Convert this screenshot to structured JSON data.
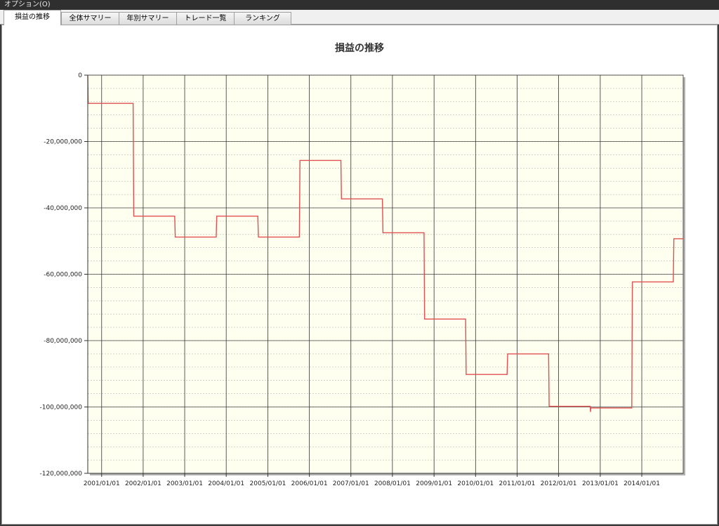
{
  "menu": {
    "options_label": "オプション(O)"
  },
  "tabs": [
    {
      "label": "損益の推移",
      "active": true
    },
    {
      "label": "全体サマリー",
      "active": false
    },
    {
      "label": "年別サマリー",
      "active": false
    },
    {
      "label": "トレード一覧",
      "active": false
    },
    {
      "label": "ランキング",
      "active": false
    }
  ],
  "chart_data": {
    "type": "line",
    "title": "損益の推移",
    "xlabel": "",
    "ylabel": "",
    "ylim": [
      -120000000,
      0
    ],
    "y_ticks": [
      0,
      -20000000,
      -40000000,
      -60000000,
      -80000000,
      -100000000,
      -120000000
    ],
    "y_tick_labels": [
      "0",
      "-20,000,000",
      "-40,000,000",
      "-60,000,000",
      "-80,000,000",
      "-100,000,000",
      "-120,000,000"
    ],
    "x_tick_labels": [
      "2001/01/01",
      "2002/01/01",
      "2003/01/01",
      "2004/01/01",
      "2005/01/01",
      "2006/01/01",
      "2007/01/01",
      "2008/01/01",
      "2009/01/01",
      "2010/01/01",
      "2011/01/01",
      "2012/01/01",
      "2013/01/01",
      "2014/01/01"
    ],
    "xlim": [
      "2000/09/01",
      "2014/12/31"
    ],
    "grid": true,
    "line_color": "#e05050",
    "plot_background": "#fffff0",
    "series": [
      {
        "name": "",
        "points": [
          [
            "2000/09/01",
            0
          ],
          [
            "2000/09/05",
            -8500000
          ],
          [
            "2001/10/05",
            -8500000
          ],
          [
            "2001/10/10",
            -42500000
          ],
          [
            "2002/10/05",
            -42500000
          ],
          [
            "2002/10/10",
            -48800000
          ],
          [
            "2003/10/05",
            -48800000
          ],
          [
            "2003/10/10",
            -42500000
          ],
          [
            "2004/10/05",
            -42500000
          ],
          [
            "2004/10/10",
            -48800000
          ],
          [
            "2005/10/05",
            -48800000
          ],
          [
            "2005/10/10",
            -25700000
          ],
          [
            "2006/10/05",
            -25700000
          ],
          [
            "2006/10/10",
            -37300000
          ],
          [
            "2007/10/05",
            -37300000
          ],
          [
            "2007/10/10",
            -47500000
          ],
          [
            "2008/10/05",
            -47500000
          ],
          [
            "2008/10/10",
            -73500000
          ],
          [
            "2009/10/05",
            -73500000
          ],
          [
            "2009/10/10",
            -90200000
          ],
          [
            "2010/10/05",
            -90200000
          ],
          [
            "2010/10/10",
            -84000000
          ],
          [
            "2011/10/05",
            -84000000
          ],
          [
            "2011/10/10",
            -99800000
          ],
          [
            "2012/10/05",
            -99800000
          ],
          [
            "2012/10/07",
            -101500000
          ],
          [
            "2012/10/10",
            -100300000
          ],
          [
            "2013/10/05",
            -100300000
          ],
          [
            "2013/10/10",
            -62300000
          ],
          [
            "2014/10/05",
            -62300000
          ],
          [
            "2014/10/10",
            -49300000
          ],
          [
            "2014/12/31",
            -49300000
          ]
        ]
      }
    ]
  }
}
